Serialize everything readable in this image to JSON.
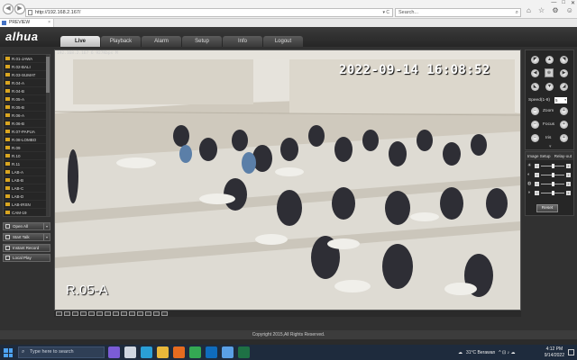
{
  "browser": {
    "url": "http://192.168.2.167/",
    "search_placeholder": "Search...",
    "tab_title": "PREVIEW",
    "nav": {
      "back": "◀",
      "forward": "▶"
    },
    "tab_close": "×",
    "addr_controls": "▾ C",
    "search_icon": "⌕",
    "toolbar_icons": [
      "⌂",
      "☆",
      "⚙",
      "☺"
    ],
    "window_controls": [
      "—",
      "□",
      "✕"
    ]
  },
  "app": {
    "logo": "alhua",
    "tabs": [
      "Live",
      "Playback",
      "Alarm",
      "Setup",
      "Info",
      "Logout"
    ],
    "active_tab": "Live"
  },
  "channels": [
    "R.01-JAWA",
    "R.02-BALI",
    "R.03-SUMAT",
    "R.04-A",
    "R.04-B",
    "R.05-A",
    "R.05-B",
    "R.06-A",
    "R.06-B",
    "R.07-PAPUA",
    "R.08-LOMBO",
    "R.09",
    "R.10",
    "R.11",
    "LAB-A",
    "LAB-B",
    "LAB-C",
    "LAB-D",
    "LAB-IRSN",
    "CAM-19"
  ],
  "side_buttons": [
    {
      "label": "Open All",
      "icon": "grid-icon",
      "dropdown": true
    },
    {
      "label": "Start Talk",
      "icon": "microphone-icon",
      "dropdown": true
    },
    {
      "label": "Instant Record",
      "icon": "record-icon",
      "dropdown": false
    },
    {
      "label": "Local Play",
      "icon": "folder-icon",
      "dropdown": false
    }
  ],
  "dropdown_arrow": "▾",
  "video": {
    "info_text": "192.168.2.167 6 927Kbps M",
    "timestamp": "2022-09-14 16:08:52",
    "room_label": "R.05-A"
  },
  "ptz": {
    "speed_label": "Speed(1-8)",
    "speed_value": "5",
    "zoom_label": "Zoom",
    "focus_label": "Focus",
    "iris_label": "Iris",
    "arrows": {
      "up": "▲",
      "down": "▼",
      "left": "◀",
      "right": "▶",
      "ul": "◤",
      "ur": "◥",
      "dl": "◣",
      "dr": "◢",
      "center": "⊕"
    },
    "minus": "−",
    "plus": "+",
    "more": "▾"
  },
  "image_setup": {
    "title": "Image Setup",
    "relay_out": "Relay-out",
    "reset_label": "Reset",
    "sliders": [
      {
        "name": "brightness",
        "icon": "☀",
        "value": 0.5
      },
      {
        "name": "contrast",
        "icon": "◐",
        "value": 0.5
      },
      {
        "name": "saturation",
        "icon": "◍",
        "value": 0.5
      },
      {
        "name": "hue",
        "icon": "◑",
        "value": 0.5
      }
    ]
  },
  "footer": {
    "copyright": "Copyright 2015,All Rights Reserved."
  },
  "taskbar": {
    "search_placeholder": "Type here to search",
    "search_icon": "⌕",
    "weather": "31°C Berawan",
    "time": "4:12 PM",
    "date": "9/14/2022",
    "tray_icons": "^ ⊡ ♪ ☁",
    "apps": [
      {
        "name": "cortana",
        "color": "#7b5cd6"
      },
      {
        "name": "task-view",
        "color": "#cfd6e0"
      },
      {
        "name": "edge",
        "color": "#2a9fd6"
      },
      {
        "name": "explorer",
        "color": "#e8b73a"
      },
      {
        "name": "firefox",
        "color": "#e66b1f"
      },
      {
        "name": "chrome",
        "color": "#34a853"
      },
      {
        "name": "outlook",
        "color": "#0f6cbd"
      },
      {
        "name": "ie",
        "color": "#5aa0e6"
      },
      {
        "name": "excel",
        "color": "#1e7145"
      }
    ]
  }
}
